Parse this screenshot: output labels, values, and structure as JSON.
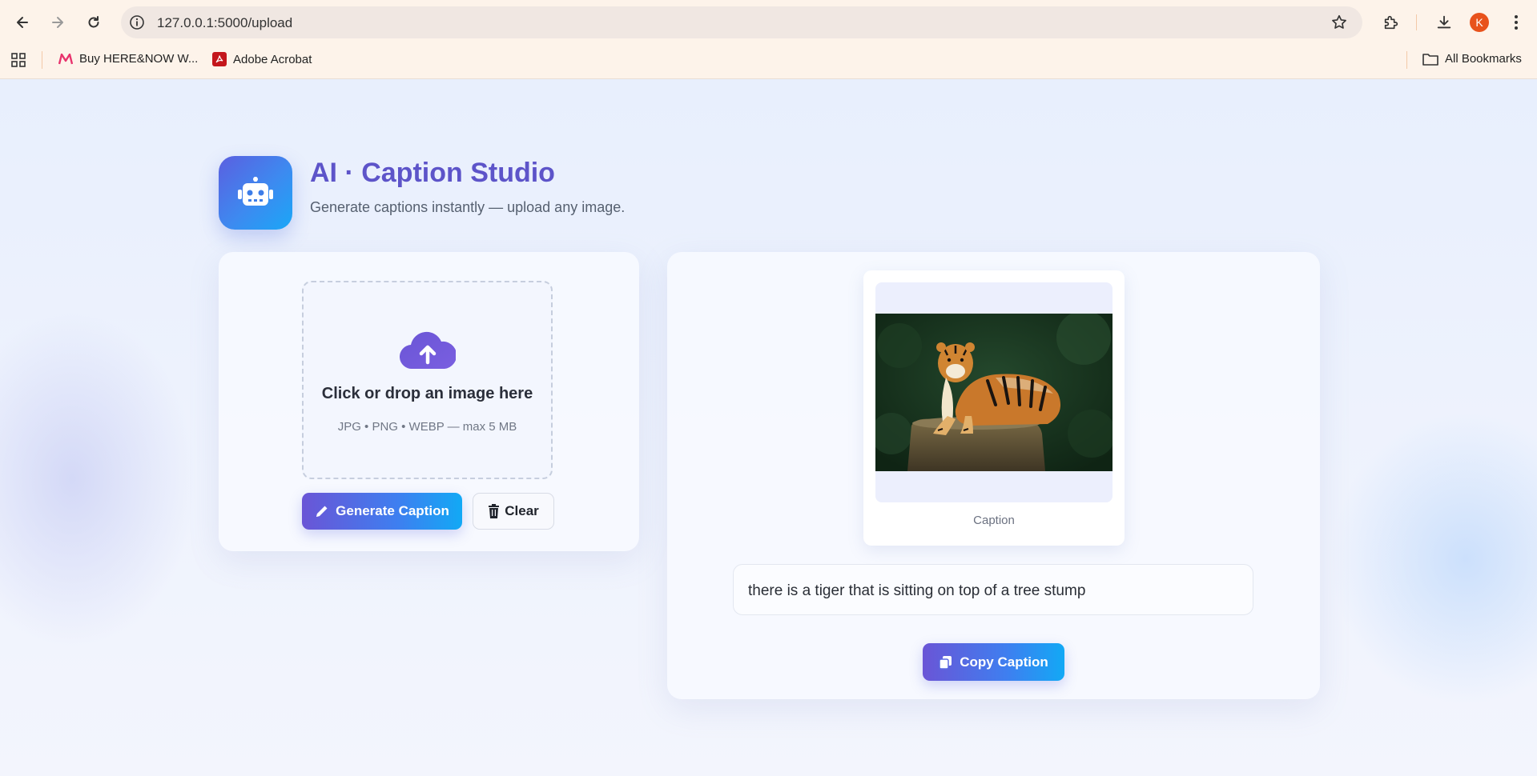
{
  "browser": {
    "url": "127.0.0.1:5000/upload",
    "profile_initial": "K",
    "bookmarks": [
      {
        "label": "Buy HERE&NOW W...",
        "icon": "myntra-icon"
      },
      {
        "label": "Adobe Acrobat",
        "icon": "acrobat-icon"
      }
    ],
    "all_bookmarks_label": "All Bookmarks"
  },
  "app": {
    "title": "AI · Caption Studio",
    "subtitle": "Generate captions instantly — upload any image.",
    "logo_icon": "robot-icon"
  },
  "upload": {
    "title": "Click or drop an image here",
    "hint": "JPG • PNG • WEBP — max 5 MB",
    "icon": "cloud-upload-icon",
    "generate_label": "Generate Caption",
    "clear_label": "Clear"
  },
  "preview": {
    "label": "Caption",
    "caption": "there is a tiger that is sitting on top of a tree stump",
    "copy_label": "Copy Caption"
  },
  "colors": {
    "accent": "#5d54c9",
    "gradient_start": "#6a55d6",
    "gradient_end": "#12a9f5"
  }
}
